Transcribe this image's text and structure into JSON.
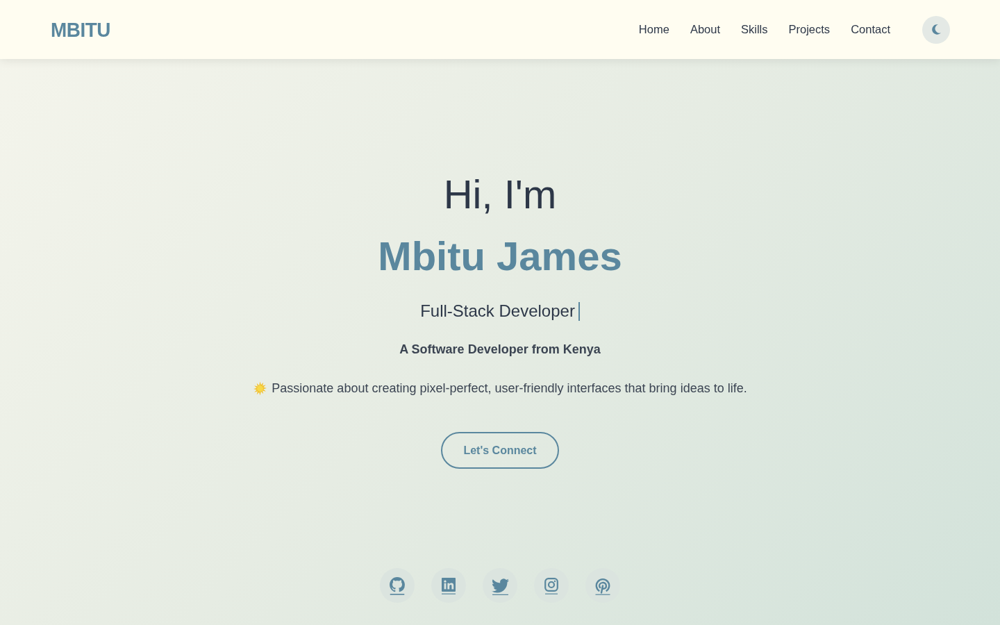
{
  "header": {
    "logo": "MBITU",
    "nav_links": [
      "Home",
      "About",
      "Skills",
      "Projects",
      "Contact"
    ]
  },
  "hero": {
    "greeting": "Hi, I'm",
    "name": "Mbitu James",
    "role": "Full-Stack Developer",
    "tagline": "A Software Developer from Kenya",
    "description": "Passionate about creating pixel-perfect, user-friendly interfaces that bring ideas to life.",
    "cta_button": "Let's Connect"
  },
  "social_links": [
    {
      "kind": "github"
    },
    {
      "kind": "linkedin"
    },
    {
      "kind": "twitter"
    },
    {
      "kind": "instagram"
    },
    {
      "kind": "pinterest"
    }
  ]
}
